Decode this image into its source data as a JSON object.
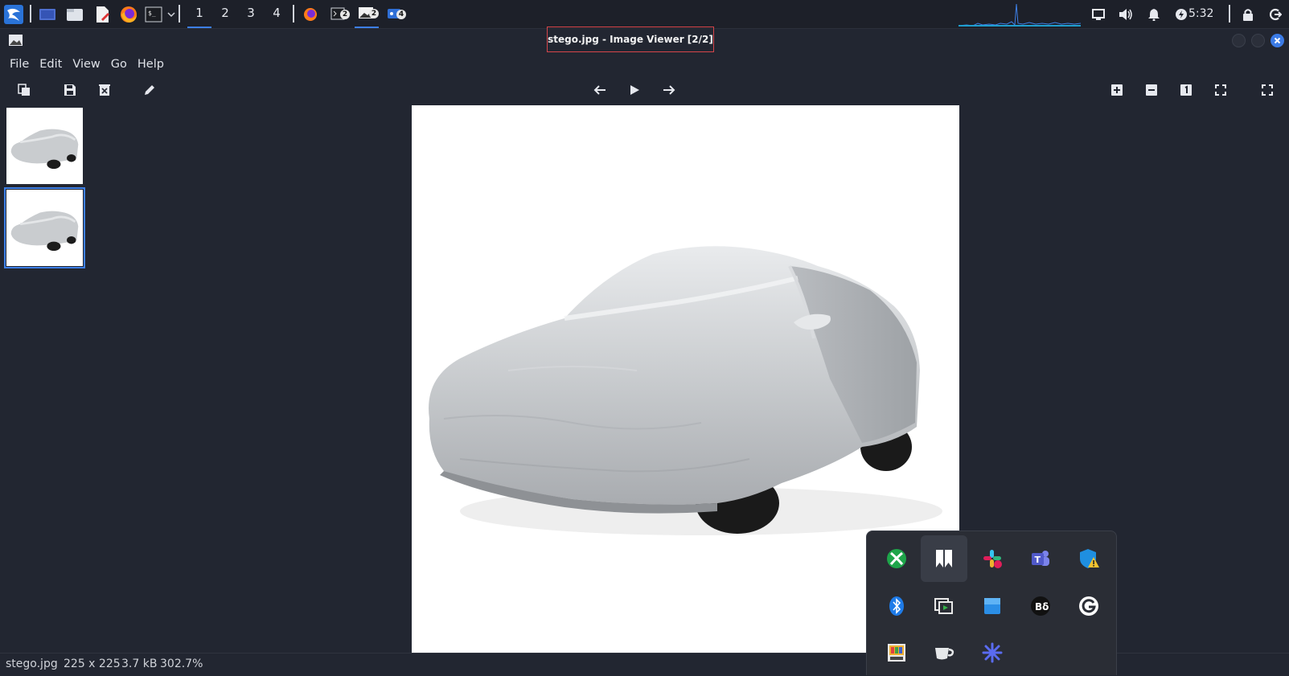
{
  "panel": {
    "workspaces": [
      "1",
      "2",
      "3",
      "4"
    ],
    "active_workspace": "1",
    "badges": {
      "terminal2": "2",
      "viewer2": "2",
      "tasks": "4"
    },
    "clock": "5:32"
  },
  "window": {
    "title": "stego.jpg - Image Viewer [2/2]"
  },
  "menubar": [
    "File",
    "Edit",
    "View",
    "Go",
    "Help"
  ],
  "statusbar": {
    "filename": "stego.jpg",
    "dimensions": "225 x 225",
    "filesize": "3.7 kB",
    "zoom": "302.7%"
  },
  "thumbnails": {
    "count": 2,
    "selected_index": 1
  },
  "tray": {
    "items": [
      "xbox-icon",
      "bookmark-app-icon",
      "slack-icon",
      "teams-icon",
      "defender-warning-icon",
      "bluetooth-icon",
      "screen-share-icon",
      "blue-box-app-icon",
      "bluffing-app-icon",
      "grammarly-icon",
      "color-picker-icon",
      "cup-icon",
      "asterisk-app-icon"
    ]
  },
  "colors": {
    "accent": "#3d7fe6",
    "title_border": "#d6454a",
    "background": "#222631"
  }
}
